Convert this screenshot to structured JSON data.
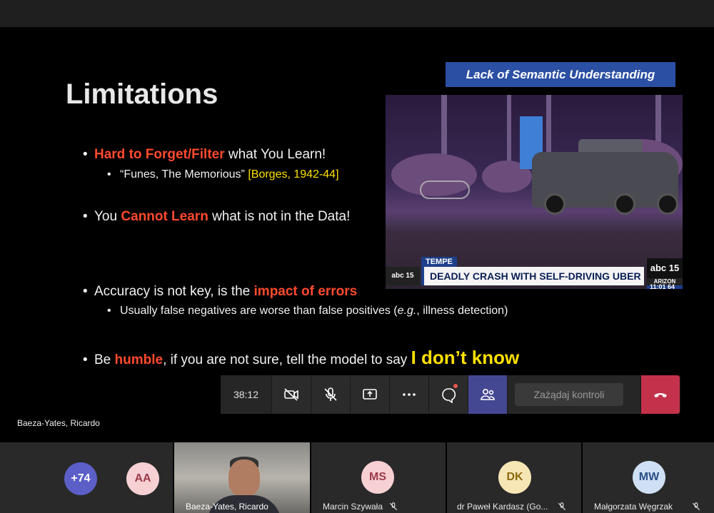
{
  "slide": {
    "title": "Limitations",
    "banner": "Lack of Semantic Understanding",
    "bullets": [
      {
        "pre": "",
        "hl": "Hard to Forget/Filter",
        "post": " what You Learn!"
      },
      {
        "pre": "You ",
        "hl": "Cannot Learn",
        "post": " what is not in the Data!"
      },
      {
        "pre": "Accuracy is not key, is the ",
        "hl": "impact of errors",
        "post": ""
      },
      {
        "pre": "Be ",
        "hl": "humble",
        "post": ", if you are not sure, tell the model to say ",
        "big": "I don’t know"
      }
    ],
    "sub1": {
      "text": "“Funes, The Memorious” ",
      "ref": "[Borges, 1942-44]"
    },
    "sub2": {
      "pre": "Usually false negatives are worse than false positives (",
      "em": "e.g.",
      "post": ", illness detection)"
    },
    "news": {
      "location": "TEMPE",
      "headline": "DEADLY CRASH WITH SELF-DRIVING UBER",
      "logo_left": "abc 15",
      "logo_right": "abc 15",
      "region": "ARIZON",
      "time": "11:01 64"
    }
  },
  "controls": {
    "timer": "38:12",
    "request_control": "Zażądaj kontroli"
  },
  "presenter": "Baeza-Yates, Ricardo",
  "participants": [
    {
      "initials": "+74"
    },
    {
      "initials": "AA"
    },
    {
      "name": "Baeza-Yates, Ricardo"
    },
    {
      "initials": "MS",
      "name": "Marcin Szywała"
    },
    {
      "initials": "DK",
      "name": "dr Paweł Kardasz (Go..."
    },
    {
      "initials": "MW",
      "name": "Małgorzata Węgrzak"
    }
  ],
  "colors": {
    "accent_red": "#ff4a2e",
    "accent_yellow": "#ffe000",
    "teams_purple": "#444791",
    "hangup": "#c4314b"
  }
}
